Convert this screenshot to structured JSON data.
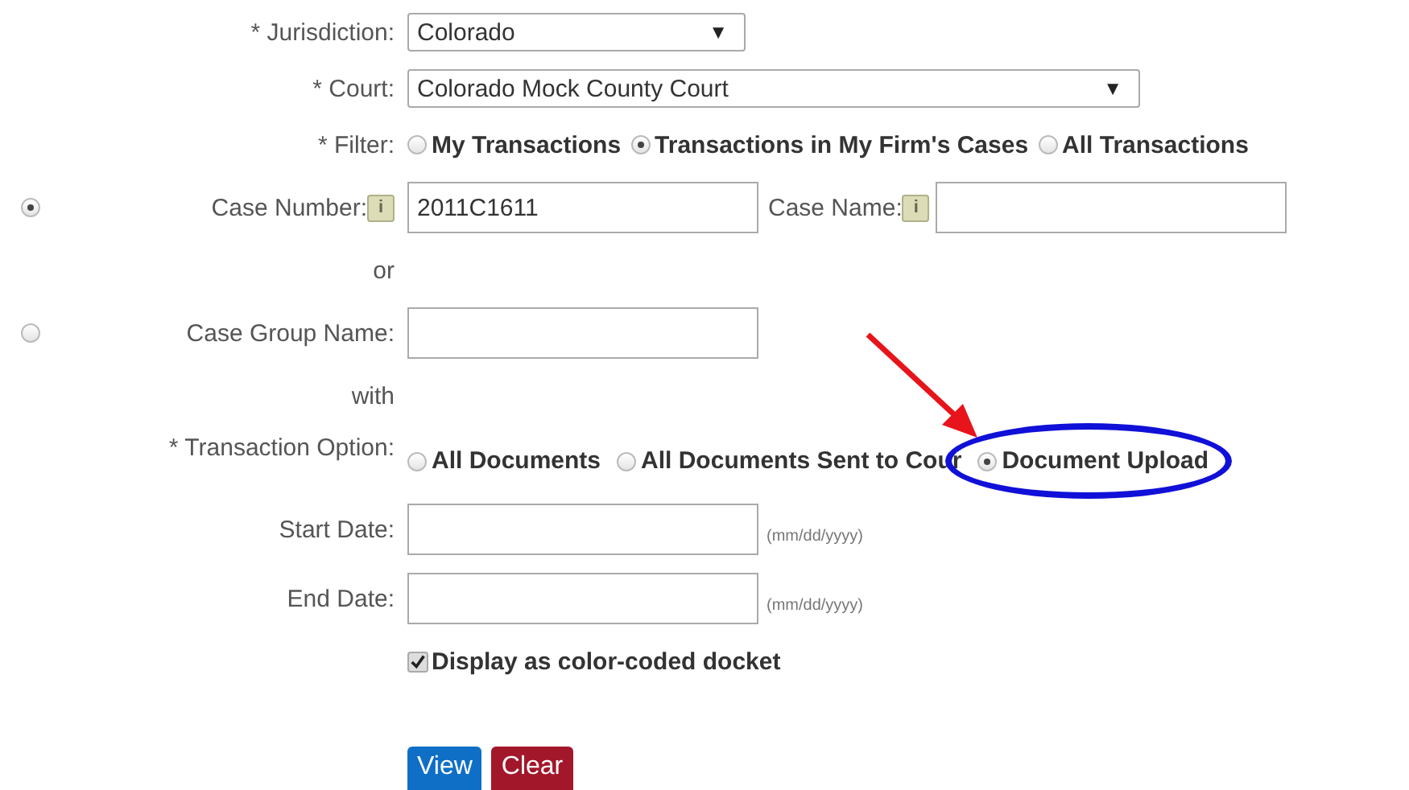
{
  "jurisdiction": {
    "label": "* Jurisdiction:",
    "value": "Colorado",
    "caret": "▼"
  },
  "court": {
    "label": "* Court:",
    "value": "Colorado Mock County Court",
    "caret": "▼"
  },
  "filter": {
    "label": "* Filter:",
    "options": [
      {
        "label": "My Transactions",
        "selected": false
      },
      {
        "label": "Transactions in My Firm's Cases",
        "selected": true
      },
      {
        "label": "All Transactions",
        "selected": false
      }
    ]
  },
  "case_number": {
    "selected": true,
    "label": "Case Number:",
    "info": "i",
    "value": "2011C1611"
  },
  "case_name": {
    "label": "Case Name:",
    "info": "i"
  },
  "or": "or",
  "case_group": {
    "selected": false,
    "label": "Case Group Name:"
  },
  "with": "with",
  "transaction_option": {
    "label": "* Transaction Option:",
    "options": [
      {
        "label": "All Documents",
        "selected": false
      },
      {
        "label": "All Documents Sent to Cour",
        "selected": false
      },
      {
        "label": "Document Upload",
        "selected": true
      }
    ]
  },
  "start_date": {
    "label": "Start Date:",
    "hint": "(mm/dd/yyyy)"
  },
  "end_date": {
    "label": "End Date:",
    "hint": "(mm/dd/yyyy)"
  },
  "docket": {
    "label": "Display as color-coded docket",
    "checked": true
  },
  "buttons": [
    {
      "label": "View",
      "kind": "primary"
    },
    {
      "label": "Clear",
      "kind": "danger"
    }
  ]
}
